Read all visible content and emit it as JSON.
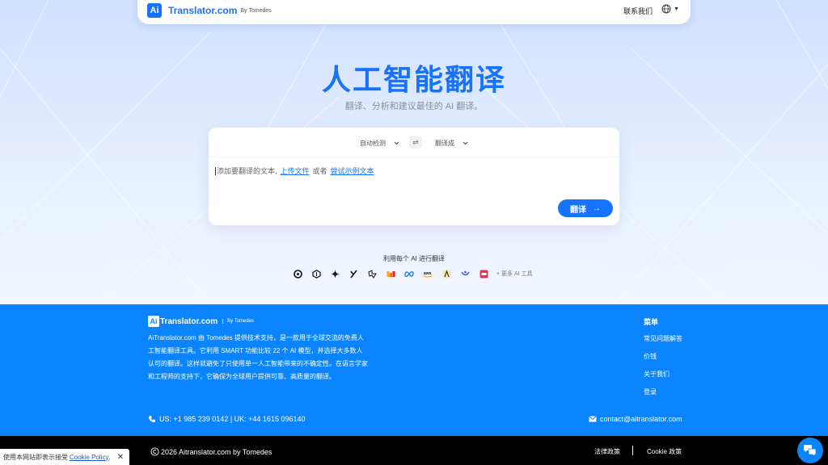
{
  "nav": {
    "logo_badge": "Ai",
    "logo_name": "Translator.com",
    "logo_by": "By Tomedes",
    "contact": "联系我们",
    "lang_caret": "▼"
  },
  "hero": {
    "title": "人工智能翻译",
    "subtitle": "翻译、分析和建议最佳的 AI 翻译。"
  },
  "translator": {
    "source_lang": "自动检测",
    "target_lang": "翻译成",
    "swap_icon": "⇌",
    "placeholder_text": "添加要翻译的文本,",
    "upload_link": "上传文件",
    "or_text": "或者",
    "sample_link": "尝试示例文本",
    "translate_label": "翻译",
    "translate_arrow": "→"
  },
  "ai_tools": {
    "heading": "利用每个 AI 进行翻译",
    "icons": [
      "openai-icon",
      "perplexity-icon",
      "gemini-icon",
      "grok-icon",
      "deepseek-icon",
      "mistral-icon",
      "meta-icon",
      "amazon-icon",
      "llama-icon",
      "qwen-icon",
      "mage-icon"
    ],
    "more": "+ 更多 AI 工具"
  },
  "footer": {
    "logo_badge": "Ai",
    "logo_name": "Translator.com",
    "logo_by": "By Tomedes",
    "description": "AiTranslator.com 由 Tomedes 提供技术支持，是一款用于全球交流的免费人工智能翻译工具。它利用 SMART 功能比较 22 个 AI 模型，并选择大多数人认可的翻译。这样就避免了只使用单一人工智能带来的不确定性。在语言学家和工程师的支持下，它确保为全球用户提供可靠、高质量的翻译。",
    "menu_title": "菜单",
    "menu_items": [
      "常见问题解答",
      "价钱",
      "关于我们",
      "登录"
    ],
    "phone": "US: +1 985 239 0142 | UK: +44 1615 096140",
    "email": "contact@aitranslator.com"
  },
  "bottom": {
    "copyright": "2026 Aitranslator.com  by Tomedes",
    "legal": "法律政策",
    "cookie_policy": "Cookie 政策"
  },
  "cookie_banner": {
    "text": "使用本网站即表示接受",
    "link": "Cookie Policy",
    "dot": ".",
    "close": "✕"
  },
  "colors": {
    "brand": "#1672ff",
    "footer": "#0a84ff"
  }
}
